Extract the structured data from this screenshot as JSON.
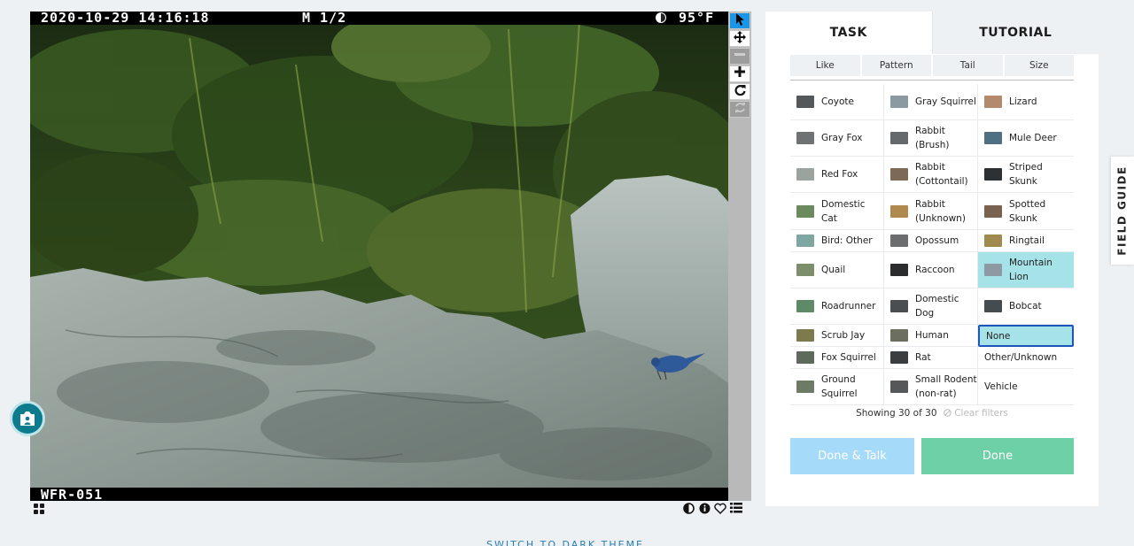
{
  "viewer": {
    "datetime": "2020-10-29 14:16:18",
    "frame": "M 1/2",
    "temperature": "95°F",
    "camera_id": "WFR-051",
    "tools": [
      "pointer-icon",
      "move-icon",
      "zoom-out-icon",
      "zoom-in-icon",
      "rotate-icon",
      "reset-icon"
    ]
  },
  "panel": {
    "tabs": [
      {
        "label": "TASK",
        "active": true
      },
      {
        "label": "TUTORIAL",
        "active": false
      }
    ],
    "filters": [
      "Like",
      "Pattern",
      "Tail",
      "Size"
    ],
    "choices": [
      {
        "label": "Coyote",
        "thumb": "#55585a"
      },
      {
        "label": "Gray Squirrel",
        "thumb": "#8a9aa0"
      },
      {
        "label": "Lizard",
        "thumb": "#b38a6c"
      },
      {
        "label": "Gray Fox",
        "thumb": "#6f7273"
      },
      {
        "label": "Rabbit (Brush)",
        "thumb": "#66696b"
      },
      {
        "label": "Mule Deer",
        "thumb": "#4f7080"
      },
      {
        "label": "Red Fox",
        "thumb": "#9aa39e"
      },
      {
        "label": "Rabbit (Cottontail)",
        "thumb": "#7d6a56"
      },
      {
        "label": "Striped Skunk",
        "thumb": "#2e3133"
      },
      {
        "label": "Domestic Cat",
        "thumb": "#6b8a5e"
      },
      {
        "label": "Rabbit (Unknown)",
        "thumb": "#b0894f"
      },
      {
        "label": "Spotted Skunk",
        "thumb": "#7a6250"
      },
      {
        "label": "Bird: Other",
        "thumb": "#7fa7a1"
      },
      {
        "label": "Opossum",
        "thumb": "#6b6d6e"
      },
      {
        "label": "Ringtail",
        "thumb": "#a08a4f"
      },
      {
        "label": "Quail",
        "thumb": "#7c8f6a"
      },
      {
        "label": "Raccoon",
        "thumb": "#2a2c2d"
      },
      {
        "label": "Mountain Lion",
        "thumb": "#8d9aa4"
      },
      {
        "label": "Roadrunner",
        "thumb": "#5f8a67"
      },
      {
        "label": "Domestic Dog",
        "thumb": "#4b4e50"
      },
      {
        "label": "Bobcat",
        "thumb": "#454c4f"
      },
      {
        "label": "Scrub Jay",
        "thumb": "#7d7a4e"
      },
      {
        "label": "Human",
        "thumb": "#6c6f60"
      },
      {
        "label": "None",
        "thumb": ""
      },
      {
        "label": "Fox Squirrel",
        "thumb": "#5e6b5c"
      },
      {
        "label": "Rat",
        "thumb": "#3b3d3e"
      },
      {
        "label": "Other/Unknown",
        "thumb": ""
      },
      {
        "label": "Ground Squirrel",
        "thumb": "#6c7a66"
      },
      {
        "label": "Small Rodent (non-rat)",
        "thumb": "#555758"
      },
      {
        "label": "Vehicle",
        "thumb": ""
      }
    ],
    "selected_choice": "Mountain Lion",
    "focused_choice": "None",
    "showing_text": "Showing 30 of 30",
    "clear_filters": "Clear filters",
    "done_talk_label": "Done & Talk",
    "done_label": "Done"
  },
  "field_guide_label": "FIELD GUIDE",
  "theme_link": "SWITCH TO DARK THEME",
  "colors": {
    "accent_blue": "#1a95e8",
    "done_green": "#6ed0a7",
    "done_talk_blue": "#a6daf9",
    "selected_teal": "#a6e3e9"
  }
}
